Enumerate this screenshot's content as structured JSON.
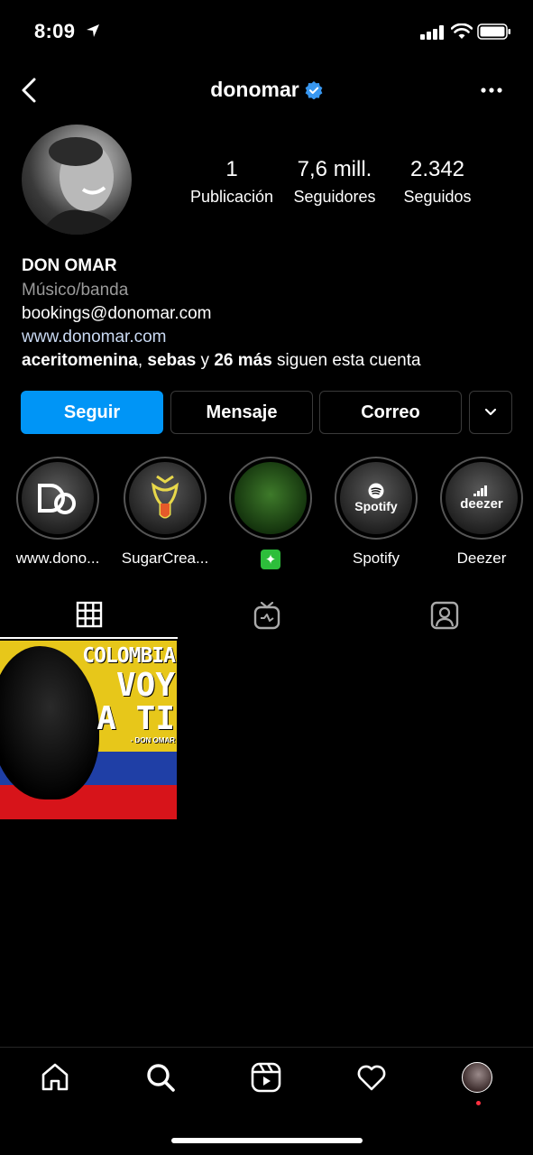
{
  "status_bar": {
    "time": "8:09"
  },
  "header": {
    "username": "donomar"
  },
  "stats": {
    "posts": {
      "value": "1",
      "label": "Publicación"
    },
    "followers": {
      "value": "7,6 mill.",
      "label": "Seguidores"
    },
    "following": {
      "value": "2.342",
      "label": "Seguidos"
    }
  },
  "bio": {
    "name": "DON OMAR",
    "category": "Músico/banda",
    "email": "bookings@donomar.com",
    "website": "www.donomar.com",
    "followed_by": {
      "user1": "aceritomenina",
      "sep": ", ",
      "user2": "sebas",
      "and": " y ",
      "more": "26 más",
      "suffix": " siguen esta cuenta"
    }
  },
  "actions": {
    "follow": "Seguir",
    "message": "Mensaje",
    "email": "Correo"
  },
  "highlights": [
    {
      "label": "www.dono...",
      "icon": "DO"
    },
    {
      "label": "SugarCrea...",
      "icon": "tongue-logo"
    },
    {
      "label": "✦",
      "icon": "sparkle"
    },
    {
      "label": "Spotify",
      "icon": "Spotify"
    },
    {
      "label": "Deezer",
      "icon": "deezer"
    }
  ],
  "post": {
    "line1": "COLOMBIA",
    "line2": "VOY",
    "line3": "A TI",
    "credit": "- DON OMAR"
  },
  "colors": {
    "accent": "#0095f6",
    "verified": "#3897f0",
    "link": "#c9d9f2"
  }
}
